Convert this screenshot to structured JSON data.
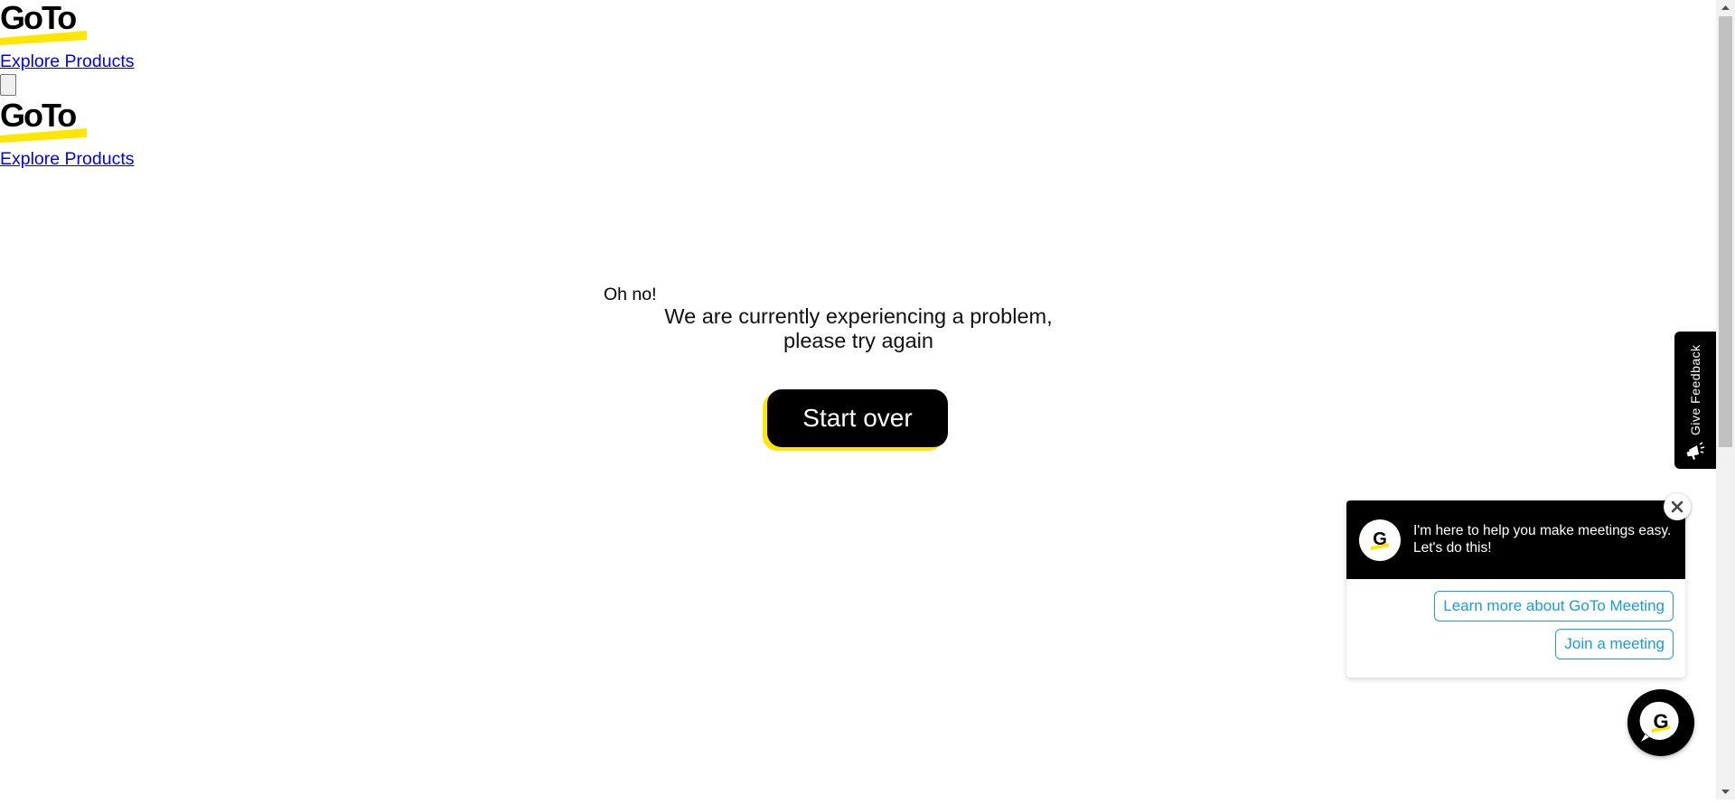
{
  "header": {
    "logo_alt": "GoTo",
    "explore_link": "Explore Products",
    "brand_yellow": "#ffe600"
  },
  "error": {
    "title": "Oh no!",
    "message_line1": "We are currently experiencing a problem,",
    "message_line2": "please try again",
    "button_label": "Start over"
  },
  "feedback": {
    "label": "Give Feedback",
    "icon": "megaphone-icon"
  },
  "chat": {
    "message": "I'm here to help you make meetings easy. Let's do this!",
    "options": [
      "Learn more about GoTo Meeting",
      "Join a meeting"
    ],
    "accent_color": "#1a9bdc",
    "close_icon": "close-icon",
    "avatar_icon": "goto-g-icon"
  }
}
